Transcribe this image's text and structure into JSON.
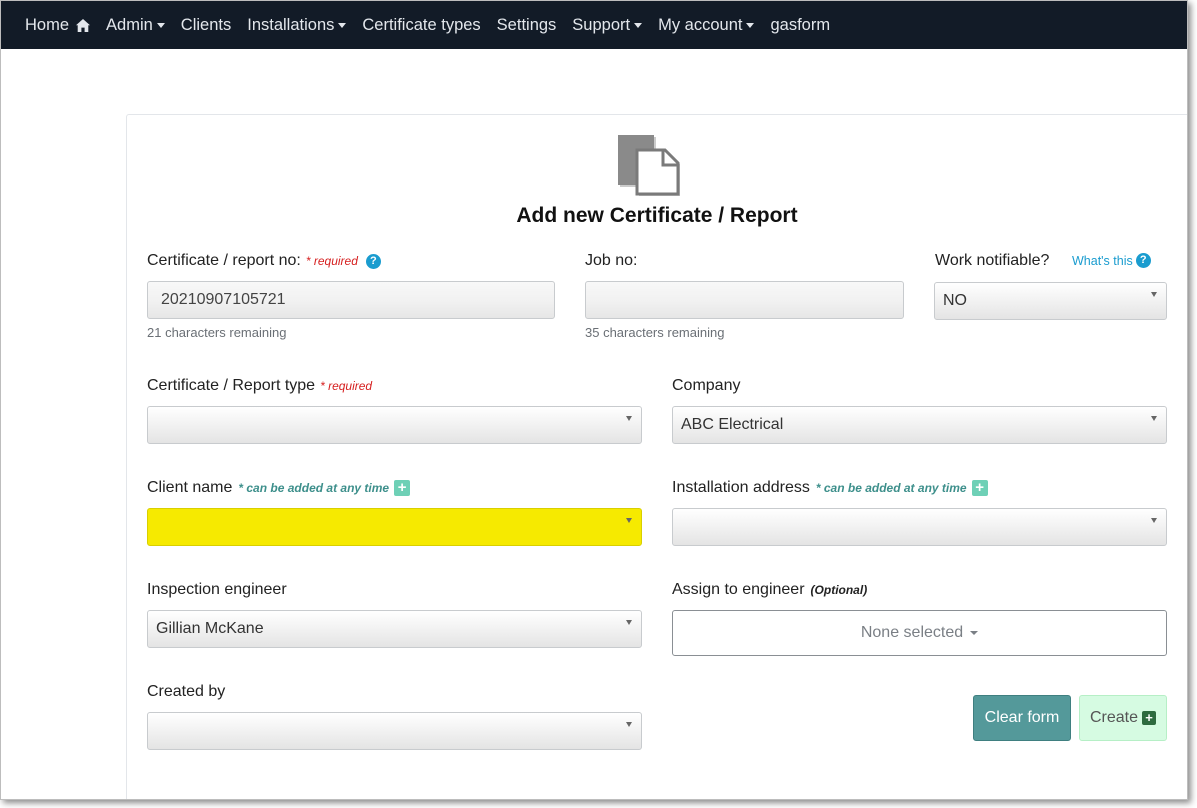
{
  "nav": {
    "home": "Home",
    "admin": "Admin",
    "clients": "Clients",
    "installations": "Installations",
    "certificate_types": "Certificate types",
    "settings": "Settings",
    "support": "Support",
    "my_account": "My account",
    "gasform": "gasform"
  },
  "page": {
    "title": "Add new Certificate / Report"
  },
  "form": {
    "cert_no": {
      "label": "Certificate / report no:",
      "required": "* required",
      "value": "20210907105721",
      "remaining": "21 characters remaining"
    },
    "job_no": {
      "label": "Job no:",
      "value": "",
      "remaining": "35 characters remaining"
    },
    "work_notifiable": {
      "label": "Work notifiable?",
      "whats_this": "What's this",
      "value": "NO"
    },
    "cert_type": {
      "label": "Certificate / Report type",
      "required": "* required",
      "value": ""
    },
    "company": {
      "label": "Company",
      "value": "ABC Electrical"
    },
    "client_name": {
      "label": "Client name",
      "hint": "* can be added at any time",
      "value": ""
    },
    "installation_address": {
      "label": "Installation address",
      "hint": "* can be added at any time",
      "value": ""
    },
    "inspection_engineer": {
      "label": "Inspection engineer",
      "value": "Gillian McKane"
    },
    "assign_engineer": {
      "label": "Assign to engineer",
      "optional": "(Optional)",
      "value": "None selected"
    },
    "created_by": {
      "label": "Created by",
      "value": ""
    }
  },
  "buttons": {
    "clear": "Clear form",
    "create": "Create"
  },
  "colors": {
    "navbar": "#121b27",
    "required": "#d62020",
    "hint": "#3d8f8b",
    "help": "#1a9ccf",
    "highlight": "#f6ea00",
    "clear_button": "#54999a",
    "create_button": "#d6fbe2"
  }
}
